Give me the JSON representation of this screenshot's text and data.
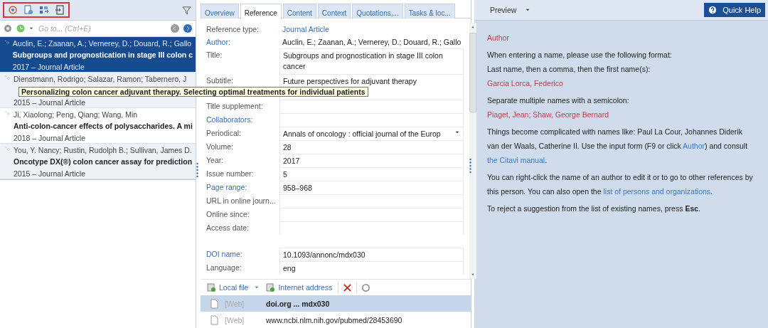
{
  "left_pane": {
    "search": {
      "placeholder": "Go to... (Ctrl+E)"
    },
    "references": [
      {
        "authors": "Auclin, E.; Zaanan, A.; Vernerey, D.; Douard, R.; Gallo",
        "title": "Subgroups and prognostication in stage III colon c",
        "meta": "2017 – Journal Article",
        "selected": true
      },
      {
        "authors": "Dienstmann, Rodrigo; Salazar, Ramon; Tabernero, J",
        "meta": "2015 – Journal Article",
        "selected": false
      },
      {
        "authors": "Ji, Xiaolong; Peng, Qiang; Wang, Min",
        "title": "Anti-colon-cancer effects of polysaccharides. A mi",
        "meta": "2018 – Journal Article",
        "selected": false
      },
      {
        "authors": "You, Y. Nancy; Rustin, Rudolph B.; Sullivan, James D.",
        "title": "Oncotype DX(®) colon cancer assay for prediction",
        "meta": "2015 – Journal Article",
        "selected": false
      }
    ],
    "tooltip": "Personalizing colon cancer adjuvant therapy. Selecting optimal treatments for individual patients"
  },
  "tabs": [
    {
      "label": "Overview",
      "selected": false
    },
    {
      "label": "Reference",
      "selected": true
    },
    {
      "label": "Content",
      "selected": false
    },
    {
      "label": "Context",
      "selected": false
    },
    {
      "label": "Quotations,...",
      "selected": false
    },
    {
      "label": "Tasks & loc...",
      "selected": false
    }
  ],
  "fields": [
    {
      "label": "Reference type:",
      "linked": false,
      "kind": "link",
      "value": "Journal Article"
    },
    {
      "label": "Author:",
      "linked": true,
      "kind": "plain",
      "value": "Auclin, E.; Zaanan, A.; Vernerey, D.; Douard, R.; Gallo"
    },
    {
      "label": "Title:",
      "linked": false,
      "kind": "multiline",
      "value": "Subgroups and prognostication in stage III colon cancer"
    },
    {
      "label": "Subtitle:",
      "linked": false,
      "kind": "multiline",
      "value": "Future perspectives for adjuvant therapy"
    },
    {
      "label": "Title supplement:",
      "linked": false,
      "kind": "box"
    },
    {
      "label": "Collaborators:",
      "linked": true,
      "kind": "box"
    },
    {
      "label": "Periodical:",
      "linked": false,
      "kind": "dropdown",
      "value": "Annals of oncology : official journal of the Europ"
    },
    {
      "label": "Volume:",
      "linked": false,
      "kind": "box",
      "value": "28"
    },
    {
      "label": "Year:",
      "linked": false,
      "kind": "box",
      "value": "2017"
    },
    {
      "label": "Issue number:",
      "linked": false,
      "kind": "box",
      "value": "5"
    },
    {
      "label": "Page range:",
      "linked": true,
      "kind": "box",
      "value": "958–968"
    },
    {
      "label": "URL in online journ...",
      "linked": false,
      "kind": "box"
    },
    {
      "label": "Online since:",
      "linked": false,
      "kind": "box"
    },
    {
      "label": "Access date:",
      "linked": false,
      "kind": "box"
    }
  ],
  "identifier_fields": [
    {
      "label": "DOI name:",
      "linked": true,
      "kind": "box",
      "value": "10.1093/annonc/mdx030"
    },
    {
      "label": "Language:",
      "linked": false,
      "kind": "box",
      "value": "eng"
    }
  ],
  "attachment_toolbar": {
    "local_file": "Local file",
    "internet_address": "Internet address"
  },
  "attachments": [
    {
      "tag": "[Web]",
      "address": "doi.org ... mdx030",
      "selected": true
    },
    {
      "tag": "[Web]",
      "address": "www.ncbi.nlm.nih.gov/pubmed/28453690",
      "selected": false
    }
  ],
  "preview": {
    "title": "Preview",
    "quick_help": "Quick Help",
    "heading": "Author",
    "paragraphs": [
      {
        "kind": "text",
        "segments": [
          {
            "kind": "text",
            "text": "When entering a name, please use the following format:"
          }
        ]
      },
      {
        "kind": "tight",
        "segments": [
          {
            "kind": "text",
            "text": "Last name, then a comma, then the first name(s):"
          }
        ]
      },
      {
        "kind": "example",
        "segments": [
          {
            "kind": "text",
            "text": "Garcia Lorca, Federico"
          }
        ]
      },
      {
        "kind": "text",
        "segments": [
          {
            "kind": "text",
            "text": "Separate multiple names with a semicolon:"
          }
        ]
      },
      {
        "kind": "example",
        "segments": [
          {
            "kind": "text",
            "text": "Piaget, Jean; Shaw, George Bernard"
          }
        ]
      },
      {
        "kind": "text",
        "segments": [
          {
            "kind": "text",
            "text": "Things become complicated with names like: Paul La Cour, Johannes Diderik van der Waals, Catherine II. Use the input form (F9 or click "
          },
          {
            "kind": "link",
            "text": "Author"
          },
          {
            "kind": "text",
            "text": ") and consult "
          },
          {
            "kind": "link",
            "text": "the Citavi manual"
          },
          {
            "kind": "text",
            "text": "."
          }
        ]
      },
      {
        "kind": "text",
        "segments": [
          {
            "kind": "text",
            "text": "You can right-click the name of an author to edit it or to go to other references by this person. You can also open the "
          },
          {
            "kind": "link",
            "text": "list of persons and organizations"
          },
          {
            "kind": "text",
            "text": "."
          }
        ]
      },
      {
        "kind": "text",
        "segments": [
          {
            "kind": "text",
            "text": "To reject a suggestion from the list of existing names, press "
          },
          {
            "kind": "bold",
            "text": "Esc"
          },
          {
            "kind": "text",
            "text": "."
          }
        ]
      }
    ]
  }
}
